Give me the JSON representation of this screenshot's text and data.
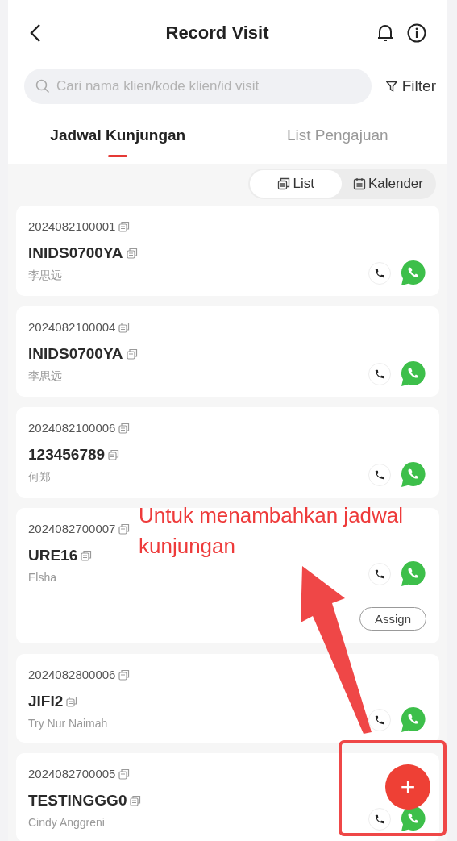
{
  "header": {
    "title": "Record Visit"
  },
  "search": {
    "placeholder": "Cari nama klien/kode klien/id visit",
    "filter_label": "Filter"
  },
  "tabs": [
    {
      "label": "Jadwal Kunjungan",
      "selected": true
    },
    {
      "label": "List Pengajuan",
      "selected": false
    }
  ],
  "view_toggle": [
    {
      "label": "List",
      "selected": true
    },
    {
      "label": "Kalender",
      "selected": false
    }
  ],
  "visits": [
    {
      "visit_id": "2024082100001",
      "client_code": "INIDS0700YA",
      "client_name": "李思远"
    },
    {
      "visit_id": "2024082100004",
      "client_code": "INIDS0700YA",
      "client_name": "李思远"
    },
    {
      "visit_id": "2024082100006",
      "client_code": "123456789",
      "client_name": "何郑"
    },
    {
      "visit_id": "2024082700007",
      "client_code": "URE16",
      "client_name": "Elsha",
      "action": "Assign"
    },
    {
      "visit_id": "2024082800006",
      "client_code": "JIFI2",
      "client_name": "Try Nur Naimah"
    },
    {
      "visit_id": "2024082700005",
      "client_code": "TESTINGGG0",
      "client_name": "Cindy Anggreni"
    }
  ],
  "fab": {
    "label": "+"
  },
  "annotation": {
    "text": "Untuk menambahkan jadwal kunjungan"
  }
}
